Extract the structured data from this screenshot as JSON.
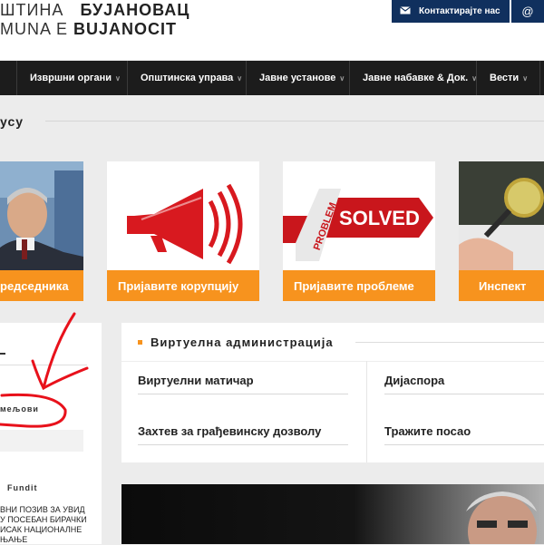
{
  "header": {
    "line1_prefix": "ШТИНА",
    "line1_name": "БУЈАНОВАЦ",
    "line2_prefix": "MUNA E",
    "line2_name": "BUJANOCIT",
    "contact_label": "Контактирајте нас",
    "contact_icon": "envelope-icon",
    "at_icon": "at-icon"
  },
  "nav": {
    "items": [
      {
        "label": "Извршни органи"
      },
      {
        "label": "Општинска управа"
      },
      {
        "label": "Јавне установе"
      },
      {
        "label": "Јавне набавке & Док."
      },
      {
        "label": "Вести"
      }
    ]
  },
  "section": {
    "title": "усу"
  },
  "cards": [
    {
      "caption": "редседника"
    },
    {
      "caption": "Пријавите корупцију"
    },
    {
      "caption": "Пријавите проблеме",
      "sign_text": "SOLVED",
      "sign_side_text": "PROBLEM"
    },
    {
      "caption": "Инспект"
    }
  ],
  "sidebar": {
    "item2": "мељови",
    "fundit": "Fundit",
    "news": "вни позив за увид у посебан бирачки исак националне њање"
  },
  "panel": {
    "title": "Виртуелна администрација",
    "links": [
      {
        "label": "Виртуелни матичар"
      },
      {
        "label": "Дијаспора"
      },
      {
        "label": "Захтев за грађевинску дозволу"
      },
      {
        "label": "Тражите посао"
      }
    ]
  },
  "colors": {
    "accent": "#f7931e",
    "nav_bg": "#1c1c1c",
    "contact_bg": "#10305e",
    "annotation": "#e8111b"
  }
}
